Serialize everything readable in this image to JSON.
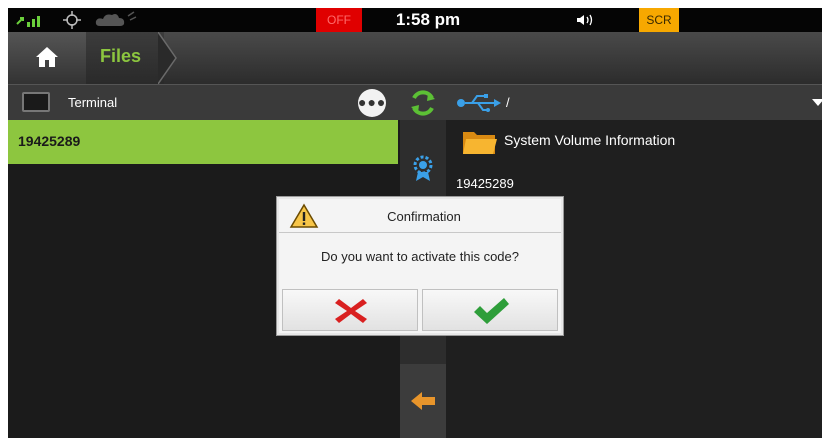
{
  "status_bar": {
    "off_label": "OFF",
    "time": "1:58 pm",
    "scr_label": "SCR"
  },
  "nav": {
    "home_icon": "home-icon",
    "files_label": "Files"
  },
  "left_pane": {
    "source_label": "Terminal",
    "items": [
      {
        "label": "19425289",
        "selected": true
      }
    ]
  },
  "right_pane": {
    "path": "/",
    "items": [
      {
        "type": "folder",
        "label": "System Volume Information"
      },
      {
        "type": "file",
        "label": "19425289"
      }
    ]
  },
  "dialog": {
    "title": "Confirmation",
    "message": "Do you want to activate this code?",
    "cancel_icon": "cross-icon",
    "confirm_icon": "check-icon"
  },
  "colors": {
    "accent_green": "#8dc63f",
    "off_red": "#e00000",
    "scr_orange": "#f7a800",
    "cancel_red": "#d92020",
    "confirm_green": "#2e9e3a"
  }
}
